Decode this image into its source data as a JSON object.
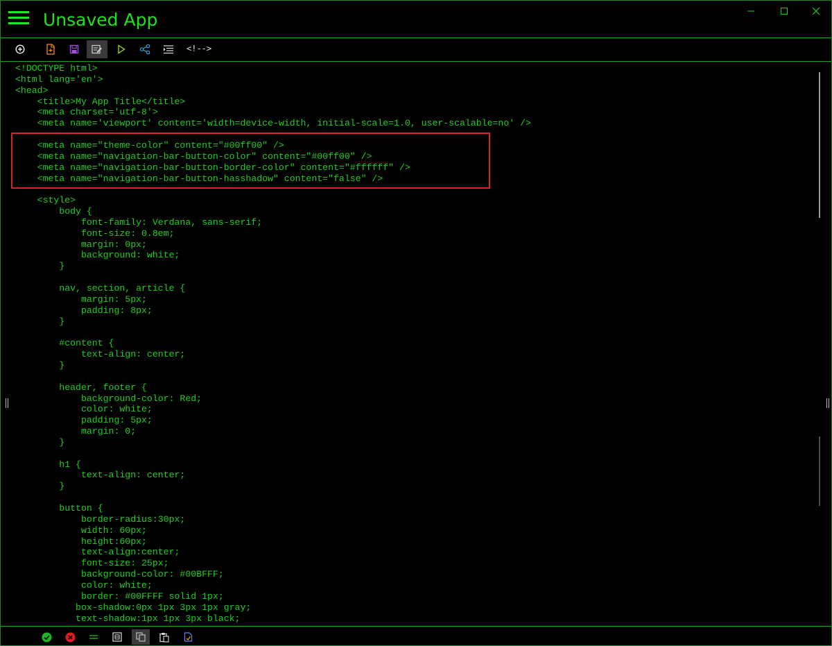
{
  "app": {
    "title": "Unsaved App",
    "window_controls": {
      "minimize": "—",
      "maximize": "☐",
      "close": "✕"
    }
  },
  "toolbar": {
    "buttons": [
      {
        "name": "add-icon",
        "label": "New"
      },
      {
        "name": "new-file-icon",
        "label": "New file"
      },
      {
        "name": "save-icon",
        "label": "Save"
      },
      {
        "name": "edit-icon",
        "label": "Edit"
      },
      {
        "name": "run-icon",
        "label": "Run"
      },
      {
        "name": "share-icon",
        "label": "Share"
      },
      {
        "name": "format-icon",
        "label": "Format"
      }
    ],
    "comment_label": "<!-->"
  },
  "editor": {
    "lines": [
      "<!DOCTYPE html>",
      "<html lang='en'>",
      "<head>",
      "    <title>My App Title</title>",
      "    <meta charset='utf-8'>",
      "    <meta name='viewport' content='width=device-width, initial-scale=1.0, user-scalable=no' />",
      "",
      "    <meta name=\"theme-color\" content=\"#00ff00\" />",
      "    <meta name=\"navigation-bar-button-color\" content=\"#00ff00\" />",
      "    <meta name=\"navigation-bar-button-border-color\" content=\"#ffffff\" />",
      "    <meta name=\"navigation-bar-button-hasshadow\" content=\"false\" />",
      "",
      "    <style>",
      "        body {",
      "            font-family: Verdana, sans-serif;",
      "            font-size: 0.8em;",
      "            margin: 0px;",
      "            background: white;",
      "        }",
      "",
      "        nav, section, article {",
      "            margin: 5px;",
      "            padding: 8px;",
      "        }",
      "",
      "        #content {",
      "            text-align: center;",
      "        }",
      "",
      "        header, footer {",
      "            background-color: Red;",
      "            color: white;",
      "            padding: 5px;",
      "            margin: 0;",
      "        }",
      "",
      "        h1 {",
      "            text-align: center;",
      "        }",
      "",
      "        button {",
      "            border-radius:30px;",
      "            width: 60px;",
      "            height:60px;",
      "            text-align:center;",
      "            font-size: 25px;",
      "            background-color: #00BFFF;",
      "            color: white;",
      "            border: #00FFFF solid 1px;",
      "           box-shadow:0px 1px 3px 1px gray;",
      "           text-shadow:1px 1px 3px black;"
    ]
  },
  "statusbar": {
    "buttons": [
      {
        "name": "ok-icon",
        "label": "OK"
      },
      {
        "name": "error-icon",
        "label": "Error"
      },
      {
        "name": "equals-icon",
        "label": "Lines"
      },
      {
        "name": "grid-icon",
        "label": "Grid"
      },
      {
        "name": "copy-icon",
        "label": "Copy"
      },
      {
        "name": "paste-icon",
        "label": "Paste"
      },
      {
        "name": "document-icon",
        "label": "Document"
      }
    ]
  },
  "colors": {
    "accent": "#19e619",
    "highlight": "#d9222a",
    "background": "#000000"
  }
}
